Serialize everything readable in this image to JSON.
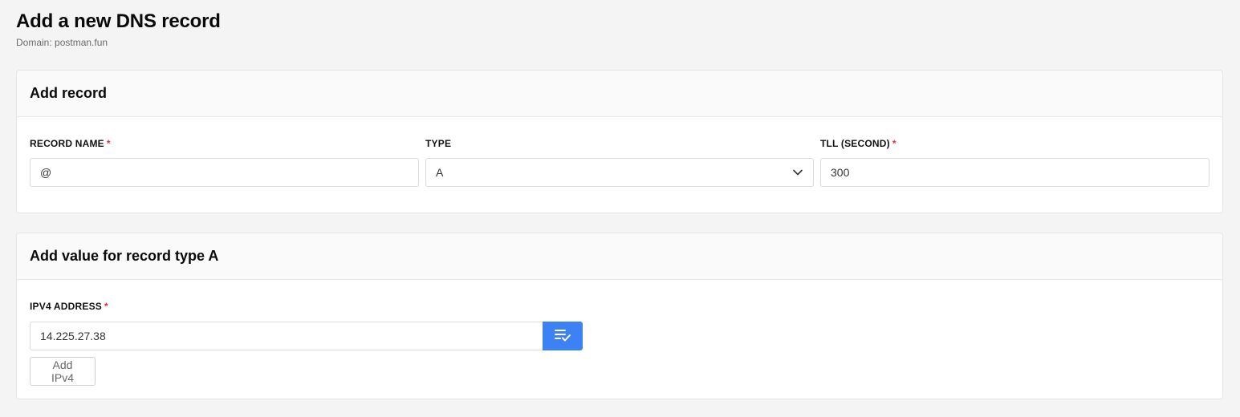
{
  "page": {
    "title": "Add a new DNS record",
    "subtitle": "Domain: postman.fun"
  },
  "record_card": {
    "title": "Add record",
    "record_name": {
      "label": "RECORD NAME",
      "required_mark": "*",
      "value": "@"
    },
    "type": {
      "label": "TYPE",
      "selected": "A"
    },
    "ttl": {
      "label": "TLL (SECOND)",
      "required_mark": "*",
      "value": "300"
    }
  },
  "value_card": {
    "title": "Add value for record type A",
    "ipv4": {
      "label": "IPV4 ADDRESS",
      "required_mark": "*",
      "value": "14.225.27.38"
    },
    "add_button_label": "Add IPv4"
  },
  "colors": {
    "accent": "#3d82f5",
    "required": "#e03131",
    "background": "#f4f4f4"
  },
  "icons": {
    "type_dropdown": "chevron-down-icon",
    "ipv4_action": "list-check-icon"
  }
}
